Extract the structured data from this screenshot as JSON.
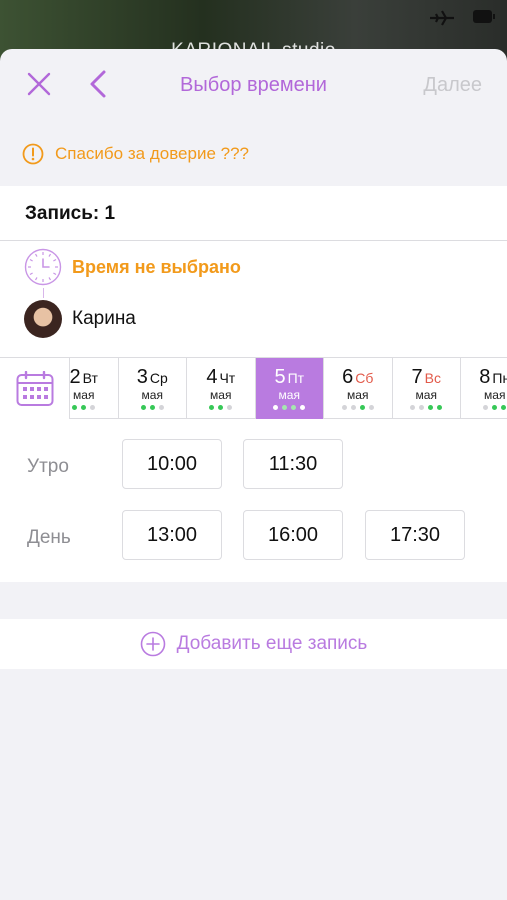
{
  "backdrop": {
    "title": "KARIONAIL studio"
  },
  "nav": {
    "title": "Выбор времени",
    "next_label": "Далее"
  },
  "notice": {
    "text": "Спасибо за доверие ???"
  },
  "booking": {
    "title": "Запись: 1",
    "time_status": "Время не выбрано",
    "master_name": "Карина"
  },
  "days": [
    {
      "num": "2",
      "weekday": "Вт",
      "month": "мая",
      "weekend": false,
      "selected": false,
      "dots": [
        true,
        true,
        false
      ]
    },
    {
      "num": "3",
      "weekday": "Ср",
      "month": "мая",
      "weekend": false,
      "selected": false,
      "dots": [
        true,
        true,
        false
      ]
    },
    {
      "num": "4",
      "weekday": "Чт",
      "month": "мая",
      "weekend": false,
      "selected": false,
      "dots": [
        true,
        true,
        false
      ]
    },
    {
      "num": "5",
      "weekday": "Пт",
      "month": "мая",
      "weekend": false,
      "selected": true,
      "dots": [
        false,
        true,
        true,
        false
      ]
    },
    {
      "num": "6",
      "weekday": "Сб",
      "month": "мая",
      "weekend": true,
      "selected": false,
      "dots": [
        false,
        false,
        true,
        false
      ]
    },
    {
      "num": "7",
      "weekday": "Вс",
      "month": "мая",
      "weekend": true,
      "selected": false,
      "dots": [
        false,
        false,
        true,
        true
      ]
    },
    {
      "num": "8",
      "weekday": "Пн",
      "month": "мая",
      "weekend": false,
      "selected": false,
      "dots": [
        false,
        true,
        true
      ]
    }
  ],
  "slots": {
    "morning_label": "Утро",
    "morning": [
      "10:00",
      "11:30"
    ],
    "day_label": "День",
    "day": [
      "13:00",
      "16:00",
      "17:30"
    ]
  },
  "add": {
    "label": "Добавить еще запись"
  },
  "colors": {
    "accent": "#b97be0",
    "warning": "#f29a1b",
    "weekend": "#e25a4a",
    "available_dot": "#37c857"
  }
}
